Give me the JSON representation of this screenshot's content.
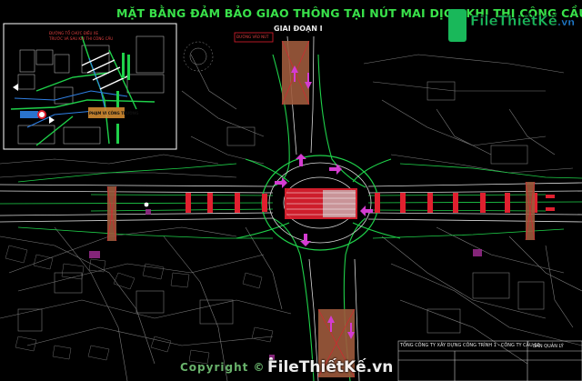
{
  "header": {
    "title": "MẶT BẰNG ĐẢM BẢO GIAO THÔNG TẠI NÚT MAI DỊCH KHI THI CÔNG CẦU",
    "subtitle": "GIAI ĐOẠN I"
  },
  "inset": {
    "notes": [
      "ĐƯỜNG TỔ CHỨC ĐIỀU XE",
      "TRƯỚC VÀ SAU KHI THI CÔNG CẦU"
    ],
    "site_label": "PHẠM VI CÔNG TRƯỜNG"
  },
  "sign_label": "ĐƯỜNG VÀO NÚT",
  "title_block": {
    "line1": "TỔNG CÔNG TY XÂY DỰNG CÔNG TRÌNH 1 - CÔNG TY CẦU 12",
    "line2": "BAN QUẢN LÝ"
  },
  "logo": {
    "text": "FileThiếtKế",
    "tld": ".vn"
  },
  "watermark": {
    "text": "FileThiếtKế.vn",
    "copyright": "Copyright ©"
  },
  "colors": {
    "title_green": "#39e14a",
    "road_green": "#1fd14a",
    "road_white": "#d9d9d9",
    "construction_red": "#e0202f",
    "arrow_magenta": "#d43cd1",
    "building_pink": "#9b2c8e",
    "pier_brown": "#9d5a3c",
    "site_orange": "#d08a30"
  }
}
